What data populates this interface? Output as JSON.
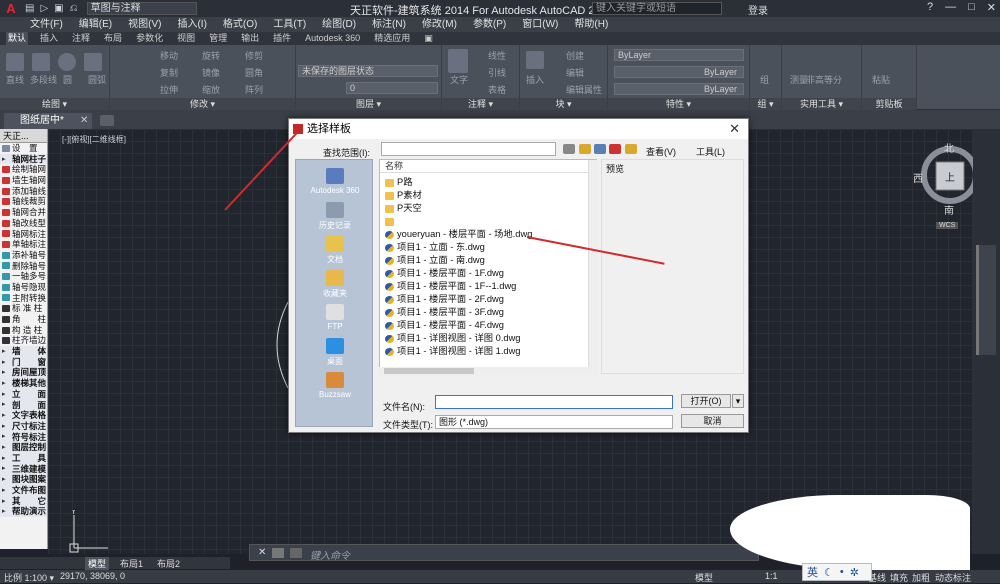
{
  "titlebar": {
    "app_btn": "A",
    "quick_access": [
      "▤",
      "▷",
      "▣",
      "⎌"
    ],
    "workspace": "草图与注释",
    "title": "天正软件-建筑系统 2014  For Autodesk AutoCAD 2014",
    "search_placeholder": "键入关键字或短语",
    "login": "登录",
    "help": "?",
    "min": "—",
    "max": "□",
    "close": "✕"
  },
  "menubar": [
    "文件(F)",
    "编辑(E)",
    "视图(V)",
    "插入(I)",
    "格式(O)",
    "工具(T)",
    "绘图(D)",
    "标注(N)",
    "修改(M)",
    "参数(P)",
    "窗口(W)",
    "帮助(H)"
  ],
  "ribbon_tabs": [
    "默认",
    "插入",
    "注释",
    "布局",
    "参数化",
    "视图",
    "管理",
    "输出",
    "插件",
    "Autodesk 360",
    "精选应用",
    "▣"
  ],
  "ribbon": {
    "draw": {
      "title": "绘图 ▾",
      "items": [
        "直线",
        "多段线",
        "圆",
        "圆弧"
      ]
    },
    "modify": {
      "title": "修改 ▾",
      "items": [
        "移动",
        "旋转",
        "修剪",
        "复制",
        "镜像",
        "圆角",
        "拉伸",
        "缩放",
        "阵列"
      ]
    },
    "layers": {
      "title": "图层 ▾",
      "unsaved": "未保存的图层状态",
      "layer_value": "0"
    },
    "annotation": {
      "title": "注释 ▾",
      "items": [
        "文字",
        "线性",
        "引线",
        "表格"
      ]
    },
    "block": {
      "title": "块 ▾",
      "items": [
        "插入",
        "创建",
        "编辑",
        "编辑属性"
      ]
    },
    "properties": {
      "title": "特性 ▾",
      "bylayer": "ByLayer"
    },
    "groups": {
      "title": "组 ▾",
      "items": [
        "组"
      ]
    },
    "utilities": {
      "title": "实用工具 ▾",
      "items": [
        "测量",
        "非高等分"
      ]
    },
    "clipboard": {
      "title": "剪贴板",
      "items": [
        "粘贴"
      ]
    }
  },
  "doc_tab": {
    "label": "图纸居中*",
    "close": "✕"
  },
  "viewport_label": "[-][俯视][二维线框]",
  "viewcube": {
    "north": "北",
    "south": "南",
    "east": "东",
    "west": "西",
    "top": "上",
    "wcs": "WCS"
  },
  "sidebar": {
    "header": "天正...",
    "items": [
      {
        "label": "设　置",
        "grp": false,
        "color": "#7a8aa8"
      },
      {
        "label": "轴网柱子",
        "grp": true,
        "color": ""
      },
      {
        "label": "绘制轴网",
        "grp": false,
        "color": "#c33"
      },
      {
        "label": "墙生轴网",
        "grp": false,
        "color": "#c33"
      },
      {
        "label": "添加轴线",
        "grp": false,
        "color": "#c33"
      },
      {
        "label": "轴线裁剪",
        "grp": false,
        "color": "#c33"
      },
      {
        "label": "轴网合并",
        "grp": false,
        "color": "#c33"
      },
      {
        "label": "轴改线型",
        "grp": false,
        "color": "#c33"
      },
      {
        "label": "轴网标注",
        "grp": false,
        "color": "#c33"
      },
      {
        "label": "单轴标注",
        "grp": false,
        "color": "#c33"
      },
      {
        "label": "添补轴号",
        "grp": false,
        "color": "#39a"
      },
      {
        "label": "删除轴号",
        "grp": false,
        "color": "#39a"
      },
      {
        "label": "一轴多号",
        "grp": false,
        "color": "#39a"
      },
      {
        "label": "轴号隐现",
        "grp": false,
        "color": "#39a"
      },
      {
        "label": "主附转换",
        "grp": false,
        "color": "#39a"
      },
      {
        "label": "标 准 柱",
        "grp": false,
        "color": "#333"
      },
      {
        "label": "角　　柱",
        "grp": false,
        "color": "#333"
      },
      {
        "label": "构 造 柱",
        "grp": false,
        "color": "#333"
      },
      {
        "label": "柱齐墙边",
        "grp": false,
        "color": "#333"
      },
      {
        "label": "墙　　体",
        "grp": true,
        "color": ""
      },
      {
        "label": "门　　窗",
        "grp": true,
        "color": ""
      },
      {
        "label": "房间屋顶",
        "grp": true,
        "color": ""
      },
      {
        "label": "楼梯其他",
        "grp": true,
        "color": ""
      },
      {
        "label": "立　　面",
        "grp": true,
        "color": ""
      },
      {
        "label": "剖　　面",
        "grp": true,
        "color": ""
      },
      {
        "label": "文字表格",
        "grp": true,
        "color": ""
      },
      {
        "label": "尺寸标注",
        "grp": true,
        "color": ""
      },
      {
        "label": "符号标注",
        "grp": true,
        "color": ""
      },
      {
        "label": "图层控制",
        "grp": true,
        "color": ""
      },
      {
        "label": "工　　具",
        "grp": true,
        "color": ""
      },
      {
        "label": "三维建模",
        "grp": true,
        "color": ""
      },
      {
        "label": "图块图案",
        "grp": true,
        "color": ""
      },
      {
        "label": "文件布图",
        "grp": true,
        "color": ""
      },
      {
        "label": "其　　它",
        "grp": true,
        "color": ""
      },
      {
        "label": "帮助演示",
        "grp": true,
        "color": ""
      }
    ]
  },
  "dialog": {
    "title": "选择样板",
    "close": "✕",
    "lookin_label": "查找范围(I):",
    "view_label": "查看(V)",
    "tools_label": "工具(L)",
    "places": [
      "Autodesk 360",
      "历史记录",
      "文档",
      "收藏夹",
      "FTP",
      "桌面",
      "Buzzsaw"
    ],
    "col_name": "名称",
    "preview_label": "预览",
    "files": [
      {
        "name": "P路",
        "type": "folder"
      },
      {
        "name": "P素材",
        "type": "folder"
      },
      {
        "name": "P天空",
        "type": "folder"
      },
      {
        "name": "",
        "type": "folder"
      },
      {
        "name": "youeryuan - 楼层平面 - 场地.dwg",
        "type": "dwg"
      },
      {
        "name": "项目1 - 立面 - 东.dwg",
        "type": "dwg"
      },
      {
        "name": "项目1 - 立面 - 南.dwg",
        "type": "dwg"
      },
      {
        "name": "项目1 - 楼层平面 - 1F.dwg",
        "type": "dwg"
      },
      {
        "name": "项目1 - 楼层平面 - 1F--1.dwg",
        "type": "dwg"
      },
      {
        "name": "项目1 - 楼层平面 - 2F.dwg",
        "type": "dwg"
      },
      {
        "name": "项目1 - 楼层平面 - 3F.dwg",
        "type": "dwg"
      },
      {
        "name": "项目1 - 楼层平面 - 4F.dwg",
        "type": "dwg"
      },
      {
        "name": "项目1 - 详图视图 - 详图 0.dwg",
        "type": "dwg"
      },
      {
        "name": "项目1 - 详图视图 - 详图 1.dwg",
        "type": "dwg"
      }
    ],
    "filename_label": "文件名(N):",
    "filename_value": "",
    "filetype_label": "文件类型(T):",
    "filetype_value": "图形 (*.dwg)",
    "open_button": "打开(O)",
    "cancel_button": "取消"
  },
  "cmdline": {
    "placeholder": "键入命令",
    "close": "✕"
  },
  "layout_tabs": [
    "模型",
    "布局1",
    "布局2"
  ],
  "status": {
    "scale": "比例 1:100 ▾",
    "coords": "29170, 38069, 0",
    "model": "模型",
    "scale2": "1:1",
    "baseline": "基线",
    "fill": "填充",
    "bold": "加粗",
    "dynamic": "动态标注"
  },
  "ime": {
    "lang": "英",
    "moon": "☾",
    "dot": "•",
    "gear": "✲"
  }
}
